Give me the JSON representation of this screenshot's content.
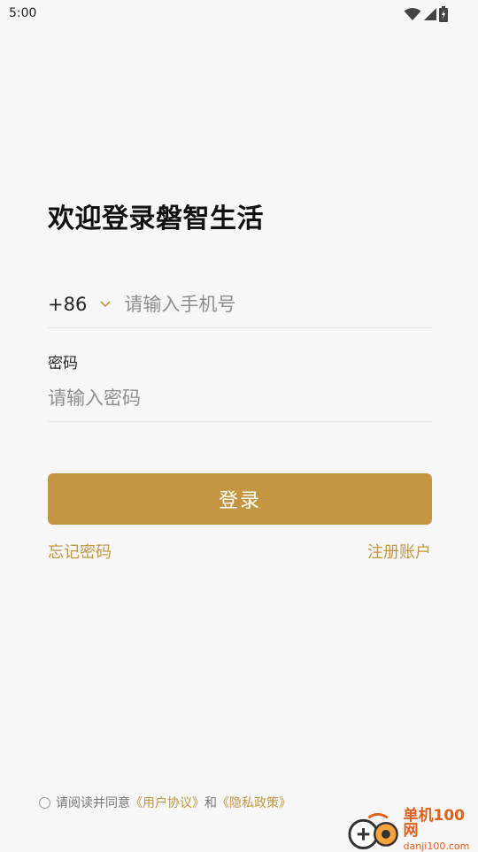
{
  "status_bar": {
    "time": "5:00",
    "icons": [
      "wifi-icon",
      "cellular-signal-icon",
      "battery-icon"
    ]
  },
  "login": {
    "title": "欢迎登录磐智生活",
    "country_code": "+86",
    "phone_placeholder": "请输入手机号",
    "phone_value": "",
    "password_label": "密码",
    "password_placeholder": "请输入密码",
    "password_value": "",
    "submit_label": "登录",
    "forgot_password": "忘记密码",
    "register": "注册账户"
  },
  "agreement": {
    "checked": false,
    "prefix": "请阅读并同意",
    "user_agreement": "《用户协议》",
    "conjunction": "和",
    "privacy_policy": "《隐私政策》"
  },
  "watermark": {
    "name": "单机100网",
    "url": "danji100.com"
  },
  "colors": {
    "accent": "#c49641",
    "background": "#f7f7f7",
    "text": "#111111",
    "placeholder": "#8e8e8e",
    "watermark": "#e0601e"
  }
}
